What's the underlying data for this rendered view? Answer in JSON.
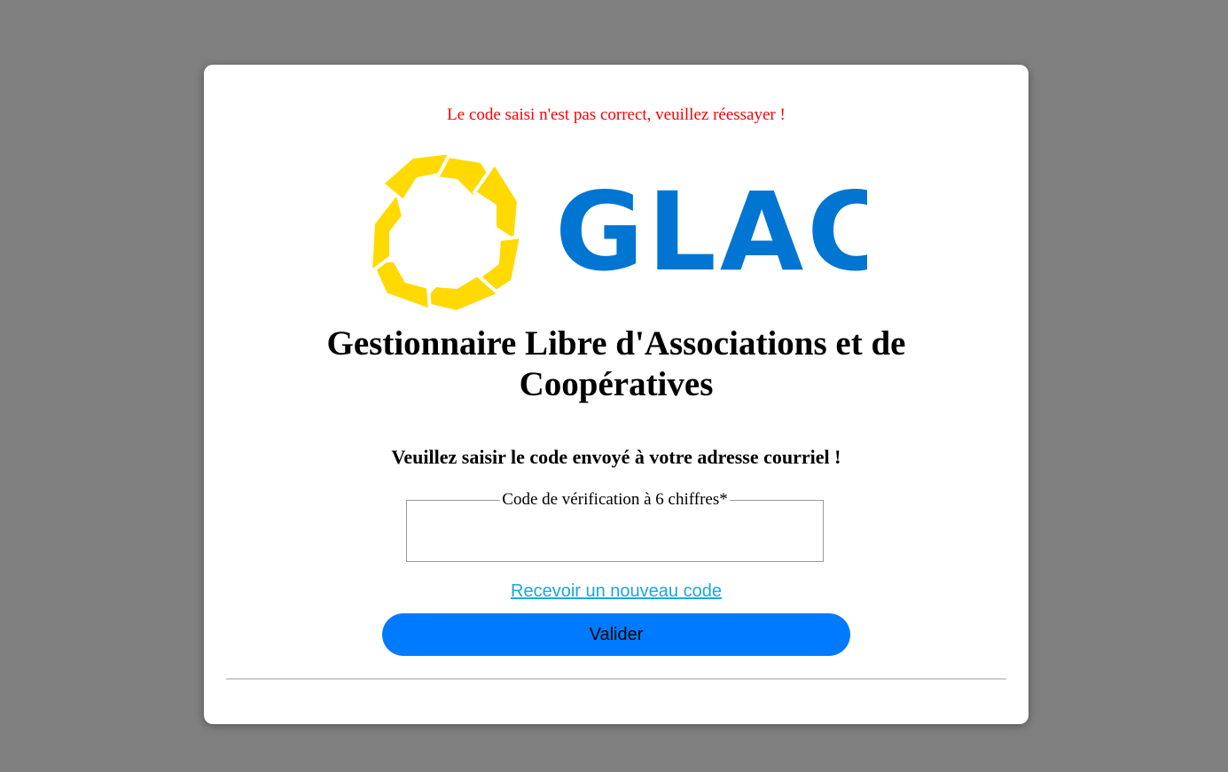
{
  "error": {
    "message": "Le code saisi n'est pas correct, veuillez réessayer !",
    "color": "#ff0000"
  },
  "logo": {
    "text": "GLAC",
    "icon": "hands-circle-logo-icon",
    "icon_color": "#ffd900",
    "text_color": "#0075d2"
  },
  "header": {
    "title": "Gestionnaire Libre d'Associations et de Coopératives"
  },
  "form": {
    "instruction": "Veuillez saisir le code envoyé à votre adresse courriel !",
    "code_field_label": "Code de vérification à 6 chiffres*",
    "code_field_value": "",
    "resend_link": "Recevoir un nouveau code",
    "submit_label": "Valider"
  },
  "colors": {
    "background": "#808080",
    "card": "#ffffff",
    "button": "#007bff",
    "link": "#1aa6e0"
  }
}
